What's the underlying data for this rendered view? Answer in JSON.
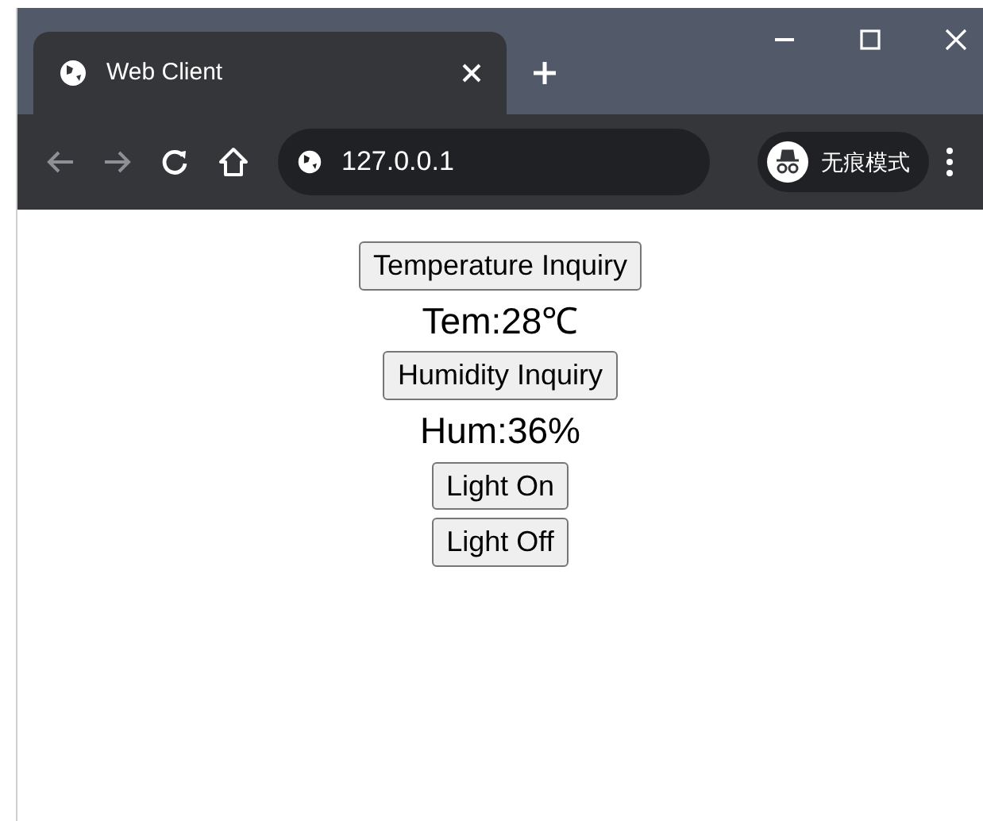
{
  "tab": {
    "title": "Web Client",
    "selected": true
  },
  "address_bar": {
    "url": "127.0.0.1"
  },
  "incognito": {
    "label": "无痕模式"
  },
  "content": [
    {
      "kind": "button",
      "text": "Temperature Inquiry"
    },
    {
      "kind": "reading",
      "text": "Tem:28℃"
    },
    {
      "kind": "button",
      "text": "Humidity Inquiry"
    },
    {
      "kind": "reading",
      "text": "Hum:36%"
    },
    {
      "kind": "button",
      "text": "Light On"
    },
    {
      "kind": "button",
      "text": "Light Off"
    }
  ]
}
